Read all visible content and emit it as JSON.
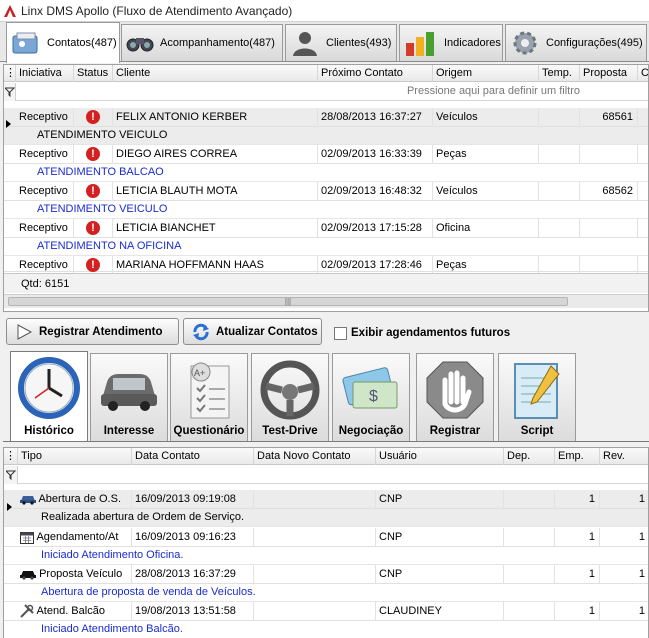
{
  "window": {
    "title": "Linx DMS Apollo (Fluxo de Atendimento Avançado)"
  },
  "tabs": [
    {
      "label": "Contatos(487)",
      "icon": "contacts-icon"
    },
    {
      "label": "Acompanhamento(487)",
      "icon": "binoculars-icon"
    },
    {
      "label": "Clientes(493)",
      "icon": "person-icon"
    },
    {
      "label": "Indicadores",
      "icon": "bar-chart-icon"
    },
    {
      "label": "Configurações(495)",
      "icon": "gear-icon"
    }
  ],
  "contacts": {
    "columns": [
      "Iniciativa",
      "Status",
      "Cliente",
      "Próximo Contato",
      "Origem",
      "Temp.",
      "Proposta",
      "C"
    ],
    "filter_hint": "Pressione aqui para definir um filtro",
    "rows": [
      {
        "iniciativa": "Receptivo",
        "cliente": "FELIX ANTONIO KERBER",
        "proximo": "28/08/2013 16:37:27",
        "origem": "Veículos",
        "proposta": "68561",
        "sub": "ATENDIMENTO VEICULO"
      },
      {
        "iniciativa": "Receptivo",
        "cliente": "DIEGO AIRES CORREA",
        "proximo": "02/09/2013 16:33:39",
        "origem": "Peças",
        "proposta": "",
        "sub": "ATENDIMENTO BALCAO"
      },
      {
        "iniciativa": "Receptivo",
        "cliente": "LETICIA BLAUTH MOTA",
        "proximo": "02/09/2013 16:48:32",
        "origem": "Veículos",
        "proposta": "68562",
        "sub": "ATENDIMENTO VEICULO"
      },
      {
        "iniciativa": "Receptivo",
        "cliente": "LETICIA BIANCHET",
        "proximo": "02/09/2013 17:15:28",
        "origem": "Oficina",
        "proposta": "",
        "sub": "ATENDIMENTO NA OFICINA"
      },
      {
        "iniciativa": "Receptivo",
        "cliente": "MARIANA HOFFMANN HAAS",
        "proximo": "02/09/2013 17:28:46",
        "origem": "Peças",
        "proposta": "",
        "sub": ""
      }
    ],
    "qtd": "Qtd: 6151"
  },
  "actions": {
    "register": "Registrar Atendimento",
    "refresh": "Atualizar Contatos",
    "future_checkbox": "Exibir agendamentos futuros",
    "future_checked": false
  },
  "panel_tabs": [
    {
      "label": "Histórico",
      "icon": "clock-icon"
    },
    {
      "label": "Interesse",
      "icon": "car-icon"
    },
    {
      "label": "Questionário",
      "icon": "checklist-icon"
    },
    {
      "label": "Test-Drive",
      "icon": "steering-wheel-icon"
    },
    {
      "label": "Negociação",
      "icon": "money-card-icon"
    },
    {
      "label": "Registrar",
      "icon": "stop-hand-icon"
    },
    {
      "label": "Script",
      "icon": "notepad-icon"
    }
  ],
  "history": {
    "columns": [
      "Tipo",
      "Data Contato",
      "Data Novo Contato",
      "Usuário",
      "Dep.",
      "Emp.",
      "Rev."
    ],
    "rows": [
      {
        "tipo": "Abertura de O.S.",
        "icon": "car-icon",
        "data": "16/09/2013 09:19:08",
        "novo": "",
        "usuario": "CNP",
        "dep": "",
        "emp": "1",
        "rev": "1",
        "sub": "Realizada abertura de Ordem de Serviço."
      },
      {
        "tipo": "Agendamento/At",
        "icon": "calendar-icon",
        "data": "16/09/2013 09:16:23",
        "novo": "",
        "usuario": "CNP",
        "dep": "",
        "emp": "1",
        "rev": "1",
        "sub": "Iniciado Atendimento Oficina."
      },
      {
        "tipo": "Proposta Veículo",
        "icon": "car-black-icon",
        "data": "28/08/2013 16:37:29",
        "novo": "",
        "usuario": "CNP",
        "dep": "",
        "emp": "1",
        "rev": "1",
        "sub": "Abertura de proposta de venda de Veículos."
      },
      {
        "tipo": "Atend. Balcão",
        "icon": "tools-icon",
        "data": "19/08/2013 13:51:58",
        "novo": "",
        "usuario": "CLAUDINEY",
        "dep": "",
        "emp": "1",
        "rev": "1",
        "sub": "Iniciado Atendimento Balcão."
      }
    ]
  },
  "colors": {
    "link_blue": "#1a2bd0",
    "error_red": "#d42020"
  }
}
